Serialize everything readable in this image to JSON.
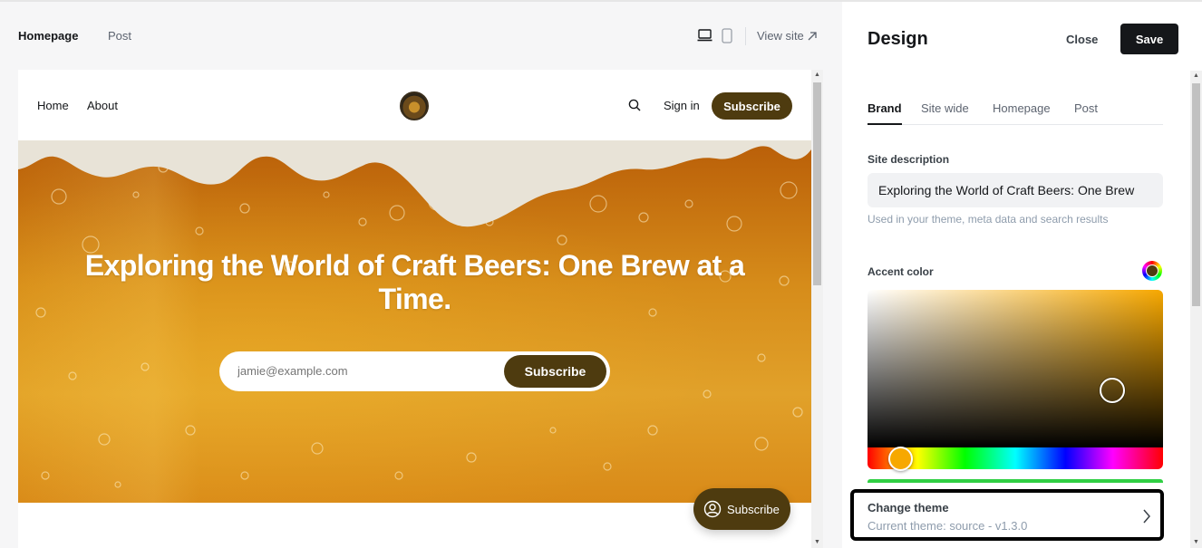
{
  "toolbar": {
    "tab_homepage": "Homepage",
    "tab_post": "Post",
    "view_site": "View site",
    "icons": [
      "desktop-icon",
      "mobile-icon",
      "external-arrow-icon"
    ]
  },
  "site": {
    "nav_home": "Home",
    "nav_about": "About",
    "sign_in": "Sign in",
    "subscribe": "Subscribe",
    "hero_title": "Exploring the World of Craft Beers: One Brew at a Time.",
    "email_placeholder": "jamie@example.com",
    "hero_subscribe": "Subscribe",
    "portal_subscribe": "Subscribe",
    "accent_color": "#4e3b0f"
  },
  "panel": {
    "title": "Design",
    "close": "Close",
    "save": "Save",
    "tabs": [
      "Brand",
      "Site wide",
      "Homepage",
      "Post"
    ],
    "active_tab": "Brand",
    "site_description_label": "Site description",
    "site_description_value": "Exploring the World of Craft Beers: One Brew",
    "site_description_hint": "Used in your theme, meta data and search results",
    "accent_label": "Accent color",
    "picker_hue_color": "#f7a800",
    "change_theme_title": "Change theme",
    "change_theme_sub": "Current theme: source - v1.3.0"
  }
}
